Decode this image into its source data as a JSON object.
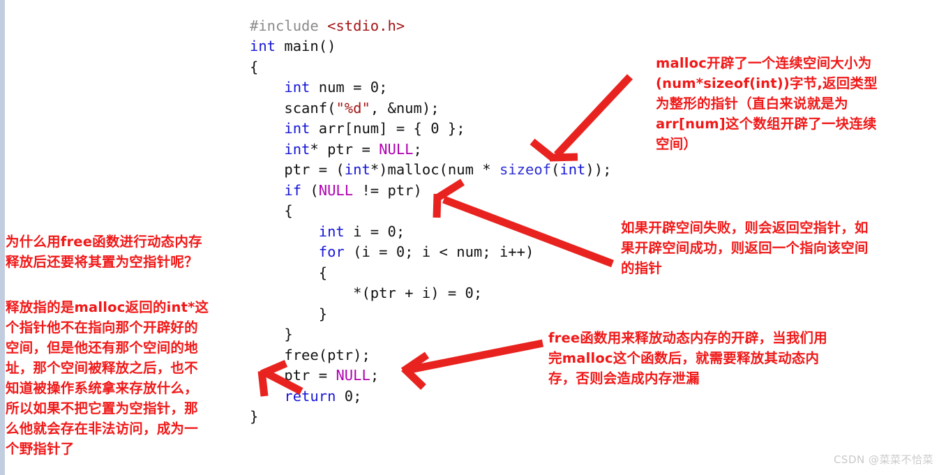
{
  "colors": {
    "annotation_red": "#f01818",
    "arrow_red": "#e8231f",
    "keyword_blue": "#1616d6",
    "preprocessor_gray": "#8a8a8a",
    "header_dark_red": "#a31515",
    "macro_magenta": "#b000b0",
    "left_bar_blue_gray": "#c3cde0",
    "watermark_gray": "#c9c9c9",
    "background": "#ffffff"
  },
  "code": {
    "language": "c",
    "lines": [
      {
        "indent": 0,
        "tokens": [
          {
            "t": "#include ",
            "c": "pre"
          },
          {
            "t": "<stdio.h>",
            "c": "hdr"
          }
        ]
      },
      {
        "indent": 0,
        "tokens": [
          {
            "t": "int",
            "c": "kw"
          },
          {
            "t": " main()",
            "c": "pl"
          }
        ]
      },
      {
        "indent": 0,
        "tokens": [
          {
            "t": "{",
            "c": "pl"
          }
        ]
      },
      {
        "indent": 1,
        "tokens": [
          {
            "t": "int",
            "c": "kw"
          },
          {
            "t": " num = 0;",
            "c": "pl"
          }
        ]
      },
      {
        "indent": 1,
        "tokens": [
          {
            "t": "scanf(",
            "c": "pl"
          },
          {
            "t": "\"%d\"",
            "c": "str"
          },
          {
            "t": ", &num);",
            "c": "pl"
          }
        ]
      },
      {
        "indent": 1,
        "tokens": [
          {
            "t": "int",
            "c": "kw"
          },
          {
            "t": " arr[num] = { 0 };",
            "c": "pl"
          }
        ]
      },
      {
        "indent": 1,
        "tokens": [
          {
            "t": "int",
            "c": "kw"
          },
          {
            "t": "* ptr = ",
            "c": "pl"
          },
          {
            "t": "NULL",
            "c": "macro"
          },
          {
            "t": ";",
            "c": "pl"
          }
        ]
      },
      {
        "indent": 1,
        "tokens": [
          {
            "t": "ptr = (",
            "c": "pl"
          },
          {
            "t": "int",
            "c": "kw"
          },
          {
            "t": "*)malloc(num * ",
            "c": "pl"
          },
          {
            "t": "sizeof",
            "c": "fn"
          },
          {
            "t": "(",
            "c": "pl"
          },
          {
            "t": "int",
            "c": "kw"
          },
          {
            "t": "));",
            "c": "pl"
          }
        ]
      },
      {
        "indent": 1,
        "tokens": [
          {
            "t": "if",
            "c": "kw"
          },
          {
            "t": " (",
            "c": "pl"
          },
          {
            "t": "NULL",
            "c": "macro"
          },
          {
            "t": " != ptr)",
            "c": "pl"
          }
        ]
      },
      {
        "indent": 1,
        "tokens": [
          {
            "t": "{",
            "c": "pl"
          }
        ]
      },
      {
        "indent": 2,
        "tokens": [
          {
            "t": "int",
            "c": "kw"
          },
          {
            "t": " i = 0;",
            "c": "pl"
          }
        ]
      },
      {
        "indent": 2,
        "tokens": [
          {
            "t": "for",
            "c": "kw"
          },
          {
            "t": " (i = 0; i < num; i++)",
            "c": "pl"
          }
        ]
      },
      {
        "indent": 2,
        "tokens": [
          {
            "t": "{",
            "c": "pl"
          }
        ]
      },
      {
        "indent": 3,
        "tokens": [
          {
            "t": "*(ptr + i) = 0;",
            "c": "pl"
          }
        ]
      },
      {
        "indent": 2,
        "tokens": [
          {
            "t": "}",
            "c": "pl"
          }
        ]
      },
      {
        "indent": 1,
        "tokens": [
          {
            "t": "}",
            "c": "pl"
          }
        ]
      },
      {
        "indent": 1,
        "tokens": [
          {
            "t": "free(ptr);",
            "c": "pl"
          }
        ]
      },
      {
        "indent": 1,
        "tokens": [
          {
            "t": "ptr = ",
            "c": "pl"
          },
          {
            "t": "NULL",
            "c": "macro"
          },
          {
            "t": ";",
            "c": "pl"
          }
        ]
      },
      {
        "indent": 1,
        "tokens": [
          {
            "t": "return",
            "c": "kw"
          },
          {
            "t": " 0;",
            "c": "pl"
          }
        ]
      },
      {
        "indent": 0,
        "tokens": [
          {
            "t": "}",
            "c": "pl"
          }
        ]
      }
    ]
  },
  "annotations": {
    "malloc_note": "malloc开辟了一个连续空间大小为\n(num*sizeof(int))字节,返回类型\n为整形的指针（直白来说就是为\narr[num]这个数组开辟了一块连续\n空间）",
    "null_check_note": "如果开辟空间失败，则会返回空指针，如\n果开辟空间成功，则返回一个指向该空间\n的指针",
    "free_note": "free函数用来释放动态内存的开辟，当我们用\n完malloc这个函数后，就需要释放其动态内\n存，否则会造成内存泄漏",
    "question_note": "为什么用free函数进行动态内存\n释放后还要将其置为空指针呢？",
    "why_null_note": "释放指的是malloc返回的int*这\n个指针他不在指向那个开辟好的\n空间，但是他还有那个空间的地\n址，那个空间被释放之后，也不\n知道被操作系统拿来存放什么，\n所以如果不把它置为空指针，那\n么他就会存在非法访问，成为一\n个野指针了"
  },
  "watermark": {
    "text": "CSDN @菜菜不恰菜"
  }
}
